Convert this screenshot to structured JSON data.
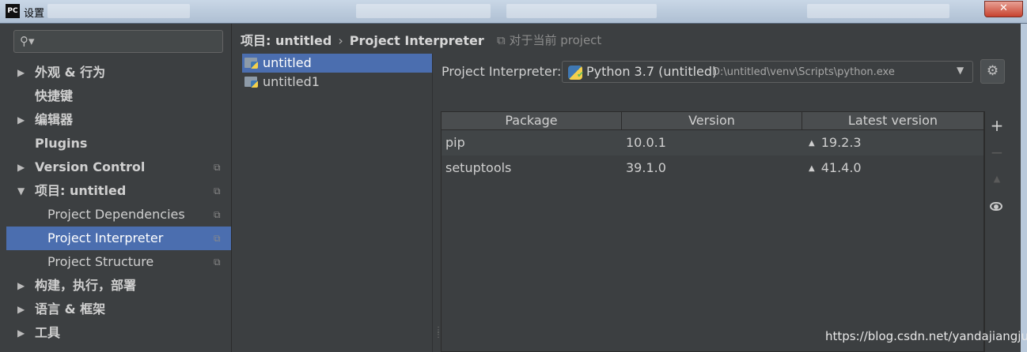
{
  "window": {
    "app_icon_text": "PC",
    "title": "设置",
    "close_glyph": "✕"
  },
  "search": {
    "placeholder": "",
    "icon": "search-icon"
  },
  "sidebar": {
    "items": [
      {
        "label": "外观 & 行为",
        "arrow": "▶",
        "copy": ""
      },
      {
        "label": "快捷键",
        "arrow": "",
        "copy": ""
      },
      {
        "label": "编辑器",
        "arrow": "▶",
        "copy": ""
      },
      {
        "label": "Plugins",
        "arrow": "",
        "copy": ""
      },
      {
        "label": "Version Control",
        "arrow": "▶",
        "copy": "⧉"
      },
      {
        "label": "项目: untitled",
        "arrow": "▼",
        "copy": "⧉"
      },
      {
        "label": "Project Dependencies",
        "arrow": "",
        "copy": "⧉"
      },
      {
        "label": "Project Interpreter",
        "arrow": "",
        "copy": "⧉"
      },
      {
        "label": "Project Structure",
        "arrow": "",
        "copy": "⧉"
      },
      {
        "label": "构建，执行，部署",
        "arrow": "▶",
        "copy": ""
      },
      {
        "label": "语言 & 框架",
        "arrow": "▶",
        "copy": ""
      },
      {
        "label": "工具",
        "arrow": "▶",
        "copy": ""
      }
    ],
    "selected_index": 7
  },
  "breadcrumb": {
    "parent": "项目: untitled",
    "separator": "›",
    "current": "Project Interpreter",
    "hint": "⧉ 对于当前 project"
  },
  "projects": [
    {
      "label": "untitled"
    },
    {
      "label": "untitled1"
    }
  ],
  "interpreter": {
    "label": "Project Interpreter:",
    "name": "Python 3.7 (untitled)",
    "path": "D:\\untitled\\venv\\Scripts\\python.exe",
    "caret": "▼",
    "gear": "⚙"
  },
  "packages": {
    "columns": [
      "Package",
      "Version",
      "Latest version"
    ],
    "rows": [
      {
        "package": "pip",
        "version": "10.0.1",
        "latest": "19.2.3",
        "upgrade_arrow": "▲"
      },
      {
        "package": "setuptools",
        "version": "39.1.0",
        "latest": "41.4.0",
        "upgrade_arrow": "▲"
      }
    ]
  },
  "toolbar": {
    "add": "+",
    "remove": "−",
    "upgrade": "▲",
    "show_early": "eye-icon"
  },
  "watermark": "https://blog.csdn.net/yandajiangjun"
}
